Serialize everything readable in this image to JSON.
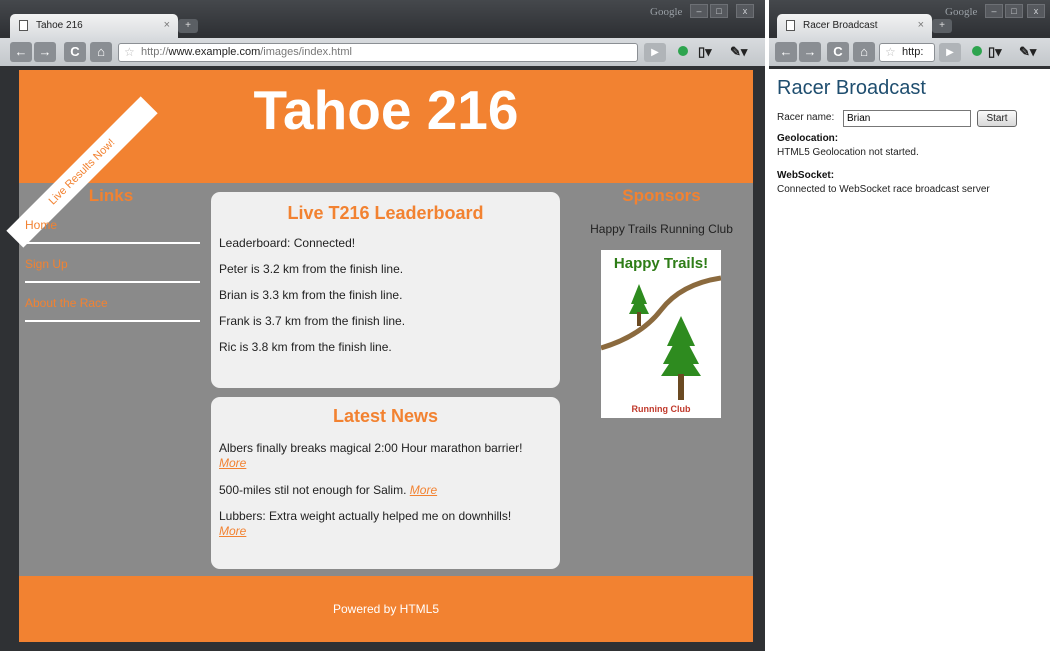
{
  "window1": {
    "tab_title": "Tahoe 216",
    "tab_close": "×",
    "newtab_label": "+",
    "brand": "Google",
    "controls": [
      "–",
      "□",
      "x"
    ],
    "url_prefix": "http://",
    "url_host": "www.example.com",
    "url_path": "/images/index.html",
    "nav": {
      "back": "←",
      "forward": "→",
      "reload": "C",
      "home": "⌂",
      "star": "☆",
      "go": "▶",
      "page": "▯▾",
      "wrench": "✎▾"
    }
  },
  "window2": {
    "tab_title": "Racer Broadcast",
    "tab_close": "×",
    "newtab_label": "+",
    "brand": "Google",
    "controls": [
      "–",
      "□",
      "x"
    ],
    "url": "http:",
    "nav": {
      "back": "←",
      "forward": "→",
      "reload": "C",
      "home": "⌂",
      "star": "☆",
      "go": "▶",
      "page": "▯▾",
      "wrench": "✎▾"
    }
  },
  "site": {
    "title": "Tahoe 216",
    "ribbon": "Live Results Now!",
    "links_title": "Links",
    "links": [
      "Home",
      "Sign Up",
      "About the Race"
    ],
    "leaderboard": {
      "title": "Live T216 Leaderboard",
      "status": "Leaderboard: Connected!",
      "entries": [
        "Peter is 3.2 km from the finish line.",
        "Brian is 3.3 km from the finish line.",
        "Frank is 3.7 km from the finish line.",
        "Ric is 3.8 km from the finish line."
      ]
    },
    "news": {
      "title": "Latest News",
      "more": "More",
      "items": [
        "Albers finally breaks magical 2:00 Hour marathon barrier!",
        "500-miles stil not enough for Salim.",
        "Lubbers: Extra weight actually helped me on downhills!"
      ]
    },
    "sponsors_title": "Sponsors",
    "sponsor_name": "Happy Trails Running Club",
    "sponsor_logo_top": "Happy Trails!",
    "sponsor_logo_bottom": "Running Club",
    "footer": "Powered by HTML5"
  },
  "racer": {
    "title": "Racer Broadcast",
    "name_label": "Racer name:",
    "name_value": "Brian",
    "start_button": "Start",
    "geo_heading": "Geolocation:",
    "geo_status": "HTML5 Geolocation not started.",
    "ws_heading": "WebSocket:",
    "ws_status": "Connected to WebSocket race broadcast server"
  },
  "colors": {
    "accent": "#f28231",
    "panel": "#8a8a8a",
    "heading_blue": "#1f4e6f"
  }
}
